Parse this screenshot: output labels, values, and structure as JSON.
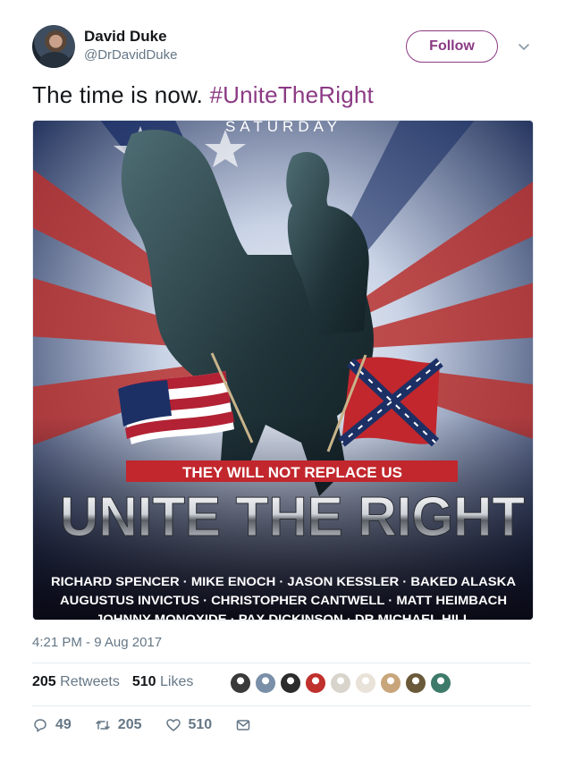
{
  "author": {
    "display_name": "David Duke",
    "handle": "@DrDavidDuke",
    "follow_label": "Follow"
  },
  "tweet": {
    "text": "The time is now. ",
    "hashtag": "#UniteTheRight",
    "timestamp": "4:21 PM - 9 Aug 2017"
  },
  "image": {
    "top_text": "SATURDAY",
    "banner": "THEY WILL NOT REPLACE US",
    "headline": "UNITE THE RIGHT",
    "speakers_line1": "RICHARD SPENCER · MIKE ENOCH · JASON KESSLER · BAKED ALASKA",
    "speakers_line2": "AUGUSTUS INVICTUS · CHRISTOPHER CANTWELL · MATT HEIMBACH",
    "speakers_line3": "JOHNNY MONOXIDE · PAX DICKINSON · DR MICHAEL HILL"
  },
  "stats": {
    "retweets_count": "205",
    "retweets_label": "Retweets",
    "likes_count": "510",
    "likes_label": "Likes"
  },
  "likers": [
    {
      "color": "#3a3a3a"
    },
    {
      "color": "#7a8fa8"
    },
    {
      "color": "#2c2c2c"
    },
    {
      "color": "#c0302c"
    },
    {
      "color": "#d8d4cc"
    },
    {
      "color": "#e9e2d8"
    },
    {
      "color": "#c8a57a"
    },
    {
      "color": "#6b5a3a"
    },
    {
      "color": "#3d7a6a"
    }
  ],
  "actions": {
    "reply_count": "49",
    "retweet_count": "205",
    "like_count": "510"
  },
  "colors": {
    "accent": "#8b3a84",
    "secondary_text": "#657786"
  },
  "icons": [
    "chevron-down-icon",
    "reply-icon",
    "retweet-icon",
    "heart-icon",
    "mail-icon"
  ]
}
